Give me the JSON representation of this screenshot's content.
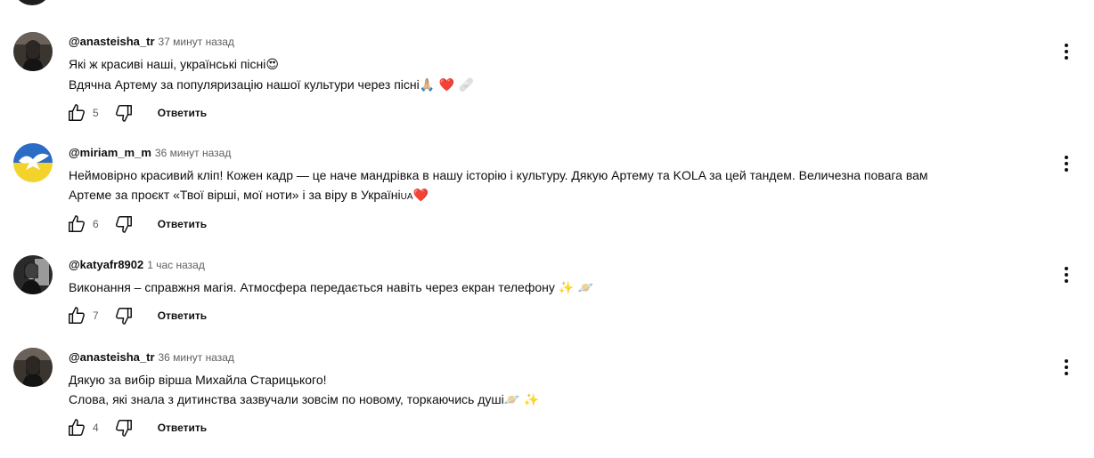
{
  "reply_label": "Ответить",
  "comments": [
    {
      "author": "@anasteisha_tr",
      "time": "37 минут назад",
      "lines": [
        {
          "text": "Які ж красиві наші, українські пісні",
          "emoji": "😍"
        },
        {
          "text": "Вдячна Артему за популяризацію нашої культури через пісні",
          "emoji": "🙏🏼 ❤️ 🩹"
        }
      ],
      "likes": "5",
      "avatar": "dark-portrait"
    },
    {
      "author": "@miriam_m_m",
      "time": "36 минут назад",
      "lines": [
        {
          "text": "Неймовірно красивий кліп! Кожен кадр — це наче мандрівка в нашу історію і культуру. Дякую Артему та KOLA за цей тандем. Величезна повага вам",
          "emoji": ""
        },
        {
          "text": "Артеме за проєкт «Твої вірші, мої ноти» і за віру в Україні",
          "flag": "UA",
          "emoji": "❤️"
        }
      ],
      "likes": "6",
      "avatar": "dove-flag"
    },
    {
      "author": "@katyafr8902",
      "time": "1 час назад",
      "lines": [
        {
          "text": "Виконання – справжня магія. Атмосфера передається навіть через екран телефону",
          "emoji": "✨ 🪐"
        }
      ],
      "likes": "7",
      "avatar": "bw-portrait"
    },
    {
      "author": "@anasteisha_tr",
      "time": "36 минут назад",
      "lines": [
        {
          "text": "Дякую за вибір вірша Михайла Старицького!",
          "emoji": ""
        },
        {
          "text": "Слова, які знала з дитинства зазвучали зовсім по новому, торкаючись душі",
          "emoji": "🪐 ✨"
        }
      ],
      "likes": "4",
      "avatar": "dark-portrait"
    }
  ]
}
